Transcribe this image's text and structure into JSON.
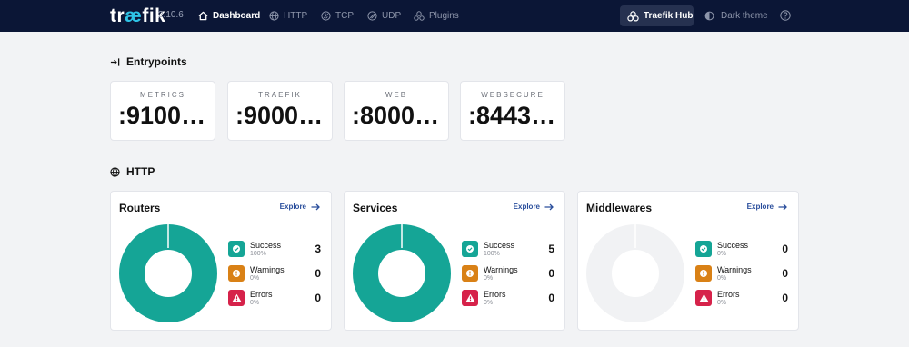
{
  "app": {
    "logo_pre": "tr",
    "logo_accent": "æ",
    "logo_post": "fik",
    "version": "2.10.6"
  },
  "nav": {
    "items": [
      {
        "label": "Dashboard",
        "icon": "home-icon",
        "active": true
      },
      {
        "label": "HTTP",
        "icon": "globe-icon",
        "active": false
      },
      {
        "label": "TCP",
        "icon": "tcp-icon",
        "active": false
      },
      {
        "label": "UDP",
        "icon": "udp-icon",
        "active": false
      },
      {
        "label": "Plugins",
        "icon": "plugins-icon",
        "active": false
      }
    ],
    "hub_label": "Traefik Hub",
    "theme_label": "Dark theme"
  },
  "entrypoints": {
    "title": "Entrypoints",
    "items": [
      {
        "name": "METRICS",
        "value": ":9100/..."
      },
      {
        "name": "TRAEFIK",
        "value": ":9000/..."
      },
      {
        "name": "WEB",
        "value": ":8000/..."
      },
      {
        "name": "WEBSECURE",
        "value": ":8443/..."
      }
    ]
  },
  "http": {
    "title": "HTTP",
    "explore_label": "Explore",
    "panels": [
      {
        "title": "Routers",
        "success": {
          "label": "Success",
          "pct": "100%",
          "count": "3"
        },
        "warnings": {
          "label": "Warnings",
          "pct": "0%",
          "count": "0"
        },
        "errors": {
          "label": "Errors",
          "pct": "0%",
          "count": "0"
        },
        "success_fraction": 1.0
      },
      {
        "title": "Services",
        "success": {
          "label": "Success",
          "pct": "100%",
          "count": "5"
        },
        "warnings": {
          "label": "Warnings",
          "pct": "0%",
          "count": "0"
        },
        "errors": {
          "label": "Errors",
          "pct": "0%",
          "count": "0"
        },
        "success_fraction": 1.0
      },
      {
        "title": "Middlewares",
        "success": {
          "label": "Success",
          "pct": "0%",
          "count": "0"
        },
        "warnings": {
          "label": "Warnings",
          "pct": "0%",
          "count": "0"
        },
        "errors": {
          "label": "Errors",
          "pct": "0%",
          "count": "0"
        },
        "success_fraction": 0.0
      }
    ]
  },
  "colors": {
    "topbar": "#0b1636",
    "success": "#15a596",
    "warning": "#d98116",
    "error": "#d6224a",
    "empty_donut": "#f1f2f4",
    "link": "#2a4e9c"
  }
}
